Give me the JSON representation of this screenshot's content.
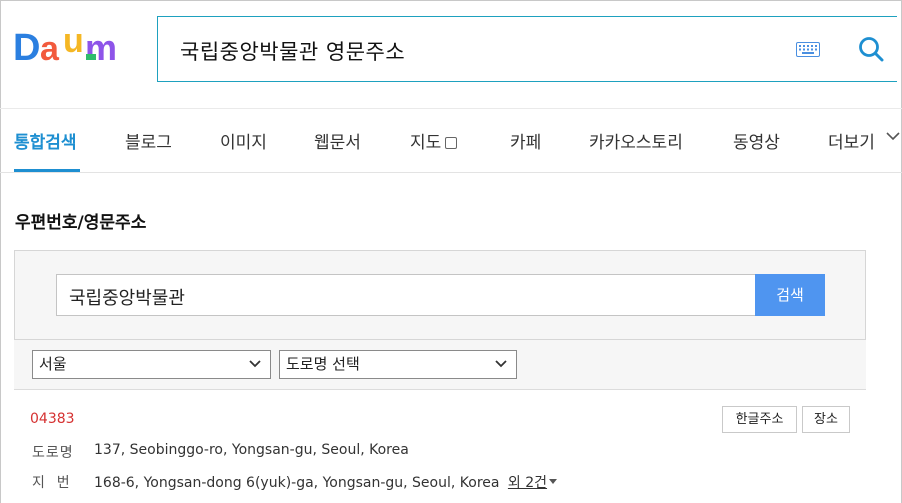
{
  "logo": {
    "text": "Daum",
    "colors": [
      "#2b7fe0",
      "#f25a3d",
      "#f5b724",
      "#2fbc6c",
      "#8e54e9"
    ]
  },
  "search": {
    "query": "국립중앙박물관 영문주소",
    "accent": "#1ea1bf"
  },
  "tabs": [
    {
      "label": "통합검색",
      "active": true
    },
    {
      "label": "블로그"
    },
    {
      "label": "이미지"
    },
    {
      "label": "웹문서"
    },
    {
      "label": "지도"
    },
    {
      "label": "카페"
    },
    {
      "label": "카카오스토리"
    },
    {
      "label": "동영상"
    },
    {
      "label": "더보기"
    }
  ],
  "section": {
    "title": "우편번호/영문주소",
    "input_value": "국립중앙박물관",
    "search_button": "검색",
    "region_select": "서울",
    "road_select": "도로명 선택"
  },
  "result": {
    "postcode": "04383",
    "road_label": "도로명",
    "road_value": "137, Seobinggo-ro, Yongsan-gu, Seoul, Korea",
    "lot_label": "지  번",
    "lot_value": "168-6, Yongsan-dong 6(yuk)-ga, Yongsan-gu, Seoul, Korea",
    "more_link": "외 2건",
    "btn_korean": "한글주소",
    "btn_place": "장소"
  }
}
